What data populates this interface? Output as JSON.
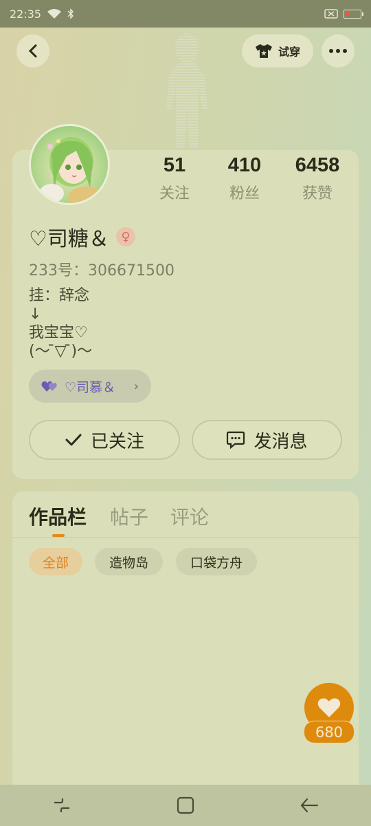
{
  "status_bar": {
    "time": "22:35"
  },
  "header": {
    "tryon_label": "试穿"
  },
  "profile": {
    "stats": [
      {
        "num": "51",
        "label": "关注"
      },
      {
        "num": "410",
        "label": "粉丝"
      },
      {
        "num": "6458",
        "label": "获赞"
      }
    ],
    "name": "♡司糖＆",
    "uid": "233号：306671500",
    "bio": "挂：辞念\n↓\n我宝宝♡\n(〜 ̄▽ ̄)〜",
    "cp_name": "♡司慕＆",
    "follow_label": "已关注",
    "message_label": "发消息"
  },
  "works": {
    "tabs": [
      "作品栏",
      "帖子",
      "评论"
    ],
    "filters": [
      "全部",
      "造物岛",
      "口袋方舟"
    ]
  },
  "like": {
    "count": "680"
  },
  "colors": {
    "accent": "#de8a0c",
    "cp": "#6a5fae"
  }
}
